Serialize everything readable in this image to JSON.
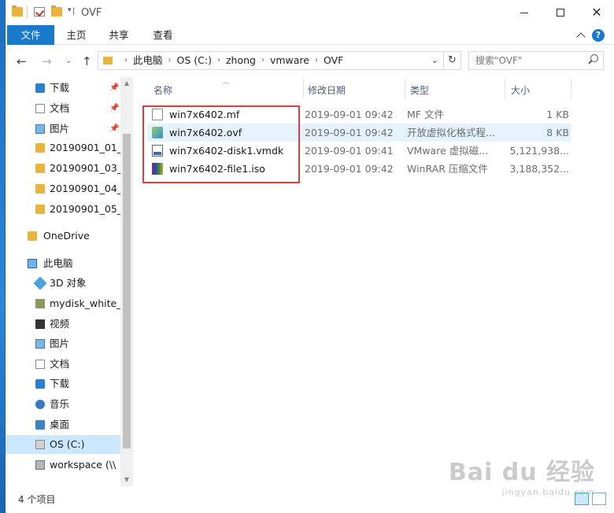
{
  "window": {
    "title": "OVF",
    "title_separator": "|"
  },
  "ribbon": {
    "tabs": [
      "文件",
      "主页",
      "共享",
      "查看"
    ],
    "help": "?"
  },
  "nav": {
    "breadcrumbs": [
      "此电脑",
      "OS (C:)",
      "zhong",
      "vmware",
      "OVF"
    ],
    "search_placeholder": "搜索\"OVF\""
  },
  "sidebar": {
    "items": [
      {
        "label": "下载",
        "pinned": true,
        "icon": "download-icon"
      },
      {
        "label": "文档",
        "pinned": true,
        "icon": "document-icon"
      },
      {
        "label": "图片",
        "pinned": true,
        "icon": "picture-icon"
      },
      {
        "label": "20190901_01_",
        "pinned": false,
        "icon": "folder-icon"
      },
      {
        "label": "20190901_03_",
        "pinned": false,
        "icon": "folder-icon"
      },
      {
        "label": "20190901_04_",
        "pinned": false,
        "icon": "folder-icon"
      },
      {
        "label": "20190901_05_",
        "pinned": false,
        "icon": "folder-icon"
      },
      {
        "label": "OneDrive",
        "pinned": false,
        "icon": "onedrive-icon"
      },
      {
        "label": "此电脑",
        "pinned": false,
        "icon": "pc-icon"
      },
      {
        "label": "3D 对象",
        "pinned": false,
        "icon": "3d-objects-icon"
      },
      {
        "label": "mydisk_white_",
        "pinned": false,
        "icon": "usb-drive-icon"
      },
      {
        "label": "视频",
        "pinned": false,
        "icon": "video-icon"
      },
      {
        "label": "图片",
        "pinned": false,
        "icon": "picture-icon"
      },
      {
        "label": "文档",
        "pinned": false,
        "icon": "document-icon"
      },
      {
        "label": "下载",
        "pinned": false,
        "icon": "download-icon"
      },
      {
        "label": "音乐",
        "pinned": false,
        "icon": "music-icon"
      },
      {
        "label": "桌面",
        "pinned": false,
        "icon": "desktop-icon"
      },
      {
        "label": "OS (C:)",
        "pinned": false,
        "icon": "drive-icon",
        "selected": true
      },
      {
        "label": "workspace (\\\\",
        "pinned": false,
        "icon": "network-drive-icon"
      }
    ]
  },
  "table": {
    "columns": [
      "名称",
      "修改日期",
      "类型",
      "大小"
    ],
    "rows": [
      {
        "name": "win7x6402.mf",
        "date": "2019-09-01 09:42",
        "type": "MF 文件",
        "size": "1 KB",
        "icon": "mf-file-icon"
      },
      {
        "name": "win7x6402.ovf",
        "date": "2019-09-01 09:42",
        "type": "开放虚拟化格式程...",
        "size": "8 KB",
        "icon": "ovf-file-icon"
      },
      {
        "name": "win7x6402-disk1.vmdk",
        "date": "2019-09-01 09:41",
        "type": "VMware 虚拟磁...",
        "size": "5,121,938...",
        "icon": "vmdk-file-icon"
      },
      {
        "name": "win7x6402-file1.iso",
        "date": "2019-09-01 09:42",
        "type": "WinRAR 压缩文件",
        "size": "3,188,352...",
        "icon": "iso-file-icon"
      }
    ]
  },
  "status": {
    "item_count": "4 个项目"
  },
  "watermark": {
    "main": "Bai du 经验",
    "sub": "jingyan.baidu.com"
  },
  "colors": {
    "accent": "#1979ca",
    "selection": "#cce8ff",
    "hover_row": "#e5f3ff",
    "highlight_box": "#e23b3b"
  }
}
